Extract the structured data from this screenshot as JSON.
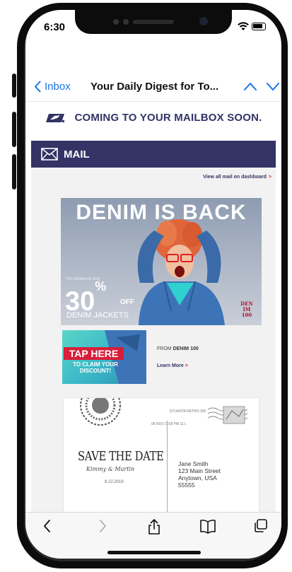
{
  "status": {
    "time": "6:30"
  },
  "nav": {
    "back_label": "Inbox",
    "title": "Your Daily Digest for To..."
  },
  "banner": {
    "text": "COMING TO YOUR MAILBOX SOON."
  },
  "mail_section": {
    "label": "MAIL"
  },
  "dashboard_link": {
    "label": "View all mail on dashboard",
    "arrow": ">"
  },
  "ad": {
    "headline": "DENIM IS BACK",
    "subtext": "This weekend only",
    "percent": "30",
    "percent_sign": "%",
    "off": "OFF",
    "product": "DENIM JACKETS",
    "logo_lines": [
      "DEN",
      "IM",
      "100"
    ],
    "tap_label": "TAP HERE",
    "tap_claim": "TO CLAIM YOUR DISCOUNT!",
    "from_prefix": "FROM",
    "from_brand": "DENIM 100",
    "learn_more": "Learn More",
    "learn_arrow": ">"
  },
  "postcard": {
    "return_address": "STUANTA RETRO 300",
    "postmark": "06 NOV 2018 PM 11 L",
    "headline": "SAVE THE DATE",
    "names": "Kimmy & Martin",
    "date": "8.22.2019",
    "recipient": [
      "Jane Smith",
      "123 Main Street",
      "Anytown, USA",
      "55555"
    ]
  },
  "toolbar": {
    "items": [
      "back-icon",
      "forward-icon",
      "share-icon",
      "bookmarks-icon",
      "tabs-icon"
    ]
  },
  "colors": {
    "usps_navy": "#333366",
    "link_blue": "#1a73e8",
    "accent_red": "#d02020"
  }
}
